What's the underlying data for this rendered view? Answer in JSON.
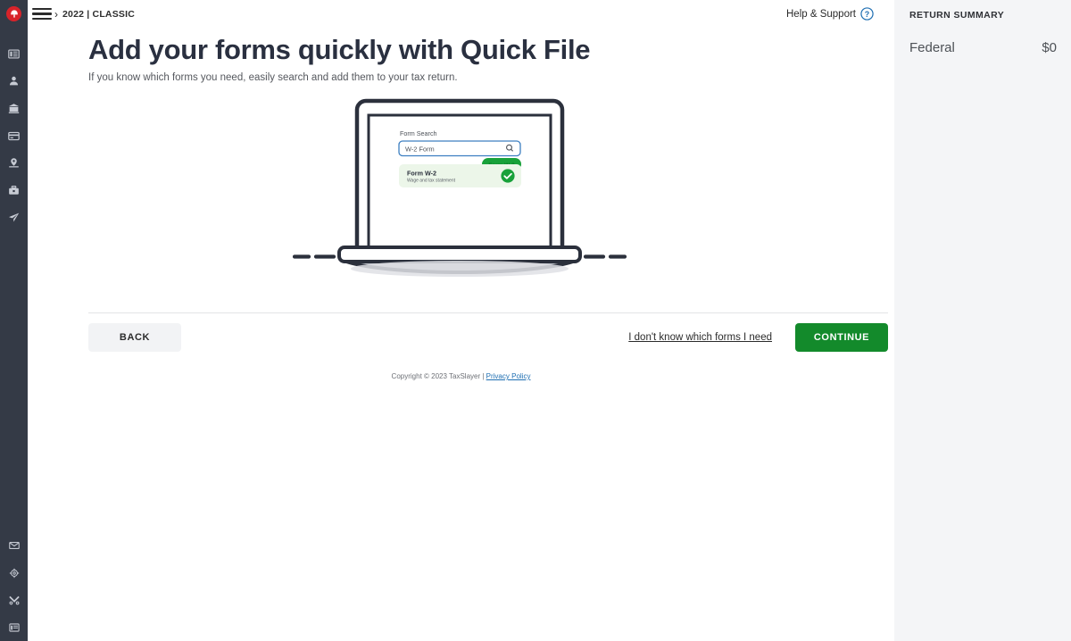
{
  "sidebar": {
    "logo_name": "taxslayer-logo",
    "items": [
      {
        "icon": "dashboard-icon",
        "label": "Dashboard"
      },
      {
        "icon": "person-icon",
        "label": "Personal Information"
      },
      {
        "icon": "bank-icon",
        "label": "Federal Section"
      },
      {
        "icon": "card-icon",
        "label": "Health Insurance"
      },
      {
        "icon": "state-pin-icon",
        "label": "State Section"
      },
      {
        "icon": "briefcase-icon",
        "label": "Summary"
      },
      {
        "icon": "paper-plane-icon",
        "label": "E-file"
      }
    ],
    "bottom_items": [
      {
        "icon": "mail-icon",
        "label": "Messages"
      },
      {
        "icon": "gear-icon",
        "label": "Settings"
      },
      {
        "icon": "tools-icon",
        "label": "Tools"
      },
      {
        "icon": "report-icon",
        "label": "Reports"
      }
    ]
  },
  "topbar": {
    "menu_icon": "hamburger-icon",
    "chevron": "›",
    "breadcrumb": "2022 | CLASSIC",
    "help_label": "Help & Support",
    "help_icon": "question-circle-icon"
  },
  "main": {
    "headline": "Add your forms quickly with Quick File",
    "subhead": "If you know which forms you need, easily search and add them to your tax return.",
    "illustration": {
      "name": "laptop-quick-file-illustration",
      "screen": {
        "search_label": "Form Search",
        "search_value": "W-2 Form",
        "search_icon": "search-icon",
        "hidden_button_label": "Form W-2",
        "result_title": "Form W-2",
        "result_subtitle": "Wage and tax statement",
        "result_check_icon": "check-circle-icon"
      }
    },
    "back_label": "BACK",
    "unsure_link_label": "I don't know which forms I need",
    "continue_label": "CONTINUE",
    "copyright_prefix": "Copyright © 2023 TaxSlayer | ",
    "privacy_label": "Privacy Policy"
  },
  "summary": {
    "title": "RETURN SUMMARY",
    "rows": [
      {
        "label": "Federal",
        "value": "$0"
      }
    ]
  },
  "colors": {
    "sidebar_bg": "#343a46",
    "logo_red": "#d8232a",
    "continue_green": "#138a2b",
    "summary_bg": "#f4f5f7",
    "headline": "#2a3040",
    "link_blue": "#1f6fb2"
  }
}
